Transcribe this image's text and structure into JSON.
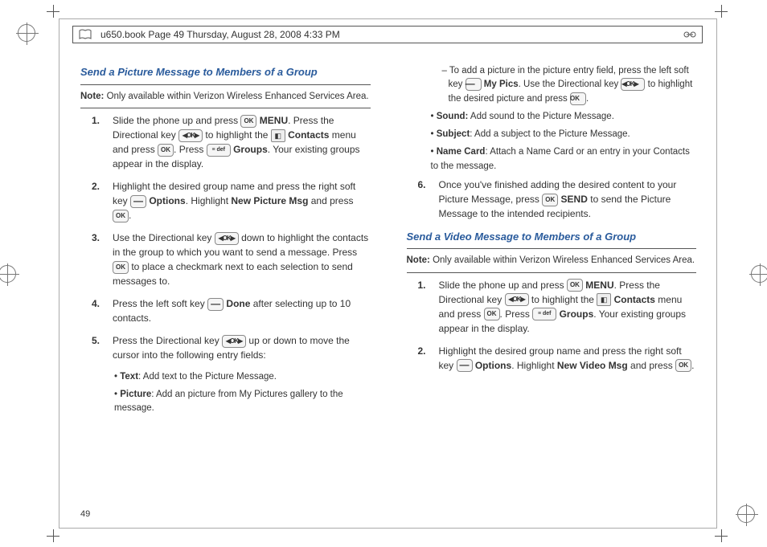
{
  "header": "u650.book  Page 49  Thursday, August 28, 2008  4:33 PM",
  "page_number": "49",
  "left": {
    "title": "Send a Picture Message to Members of a Group",
    "note_label": "Note:",
    "note_body": " Only available within Verizon Wireless Enhanced Services Area.",
    "s1a": "Slide the phone up and press ",
    "s1b": " MENU",
    "s1c": ". Press the Directional key ",
    "s1d": " to highlight the ",
    "s1e": " Contacts",
    "s1f": " menu and press ",
    "s1g": ". Press ",
    "s1h": " Groups",
    "s1i": ". Your existing groups appear in the display.",
    "s2a": "Highlight the desired group name and press the right soft key ",
    "s2b": " Options",
    "s2c": ". Highlight ",
    "s2d": "New Picture Msg",
    "s2e": " and press ",
    "s2f": ".",
    "s3a": "Use the Directional key ",
    "s3b": " down to highlight the contacts in the group to which you want to send a message. Press ",
    "s3c": " to place a checkmark next to each selection to send messages to.",
    "s4a": "Press the left soft key ",
    "s4b": " Done",
    "s4c": " after selecting up to 10 contacts.",
    "s5a": "Press the Directional key ",
    "s5b": " up or down to move the cursor into the following entry fields:",
    "sub_text_l": "Text",
    "sub_text_b": ": Add text to the Picture Message.",
    "sub_pic_l": "Picture",
    "sub_pic_b": ": Add an picture from My Pictures gallery to the message."
  },
  "right": {
    "sub_pic2a": "To add a picture in the picture entry field, press the left soft key ",
    "sub_pic2b": " My Pics",
    "sub_pic2c": ". Use the Directional key ",
    "sub_pic2d": " to highlight the desired picture and press ",
    "sub_pic2e": ".",
    "sub_sound_l": "Sound:",
    "sub_sound_b": " Add sound to the Picture Message.",
    "sub_subj_l": "Subject",
    "sub_subj_b": ": Add a subject to the Picture Message.",
    "sub_name_l": "Name Card",
    "sub_name_b": ": Attach a Name Card or an entry in your Contacts to the message.",
    "s6a": "Once you've finished adding the desired content to your Picture Message, press ",
    "s6b": " SEND",
    "s6c": " to send the Picture Message to the intended recipients.",
    "title2": "Send a Video Message to Members of a Group",
    "note2_label": "Note:",
    "note2_body": " Only available within Verizon Wireless Enhanced Services Area.",
    "v1a": "Slide the phone up and press ",
    "v1b": " MENU",
    "v1c": ". Press the Directional key ",
    "v1d": " to highlight the ",
    "v1e": " Contacts",
    "v1f": " menu and press ",
    "v1g": ". Press ",
    "v1h": " Groups",
    "v1i": ". Your existing groups appear in the display.",
    "v2a": "Highlight the desired group name and press the right soft key ",
    "v2b": " Options",
    "v2c": ". Highlight ",
    "v2d": "New Video Msg",
    "v2e": " and press ",
    "v2f": "."
  },
  "keys": {
    "ok": "OK",
    "dir": "◀OK▶",
    "dash": "—",
    "menu": "≡ def",
    "ico": "◧"
  }
}
